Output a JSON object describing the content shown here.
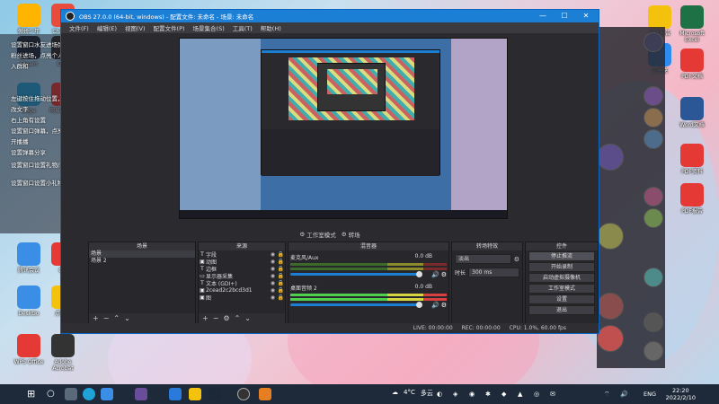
{
  "desktop": {
    "left_icons": [
      {
        "label": "傲娇少年",
        "color": "#ffb400"
      },
      {
        "label": "Chrome",
        "color": "#e74c3c"
      },
      {
        "label": "Steam",
        "color": "#1b2838"
      },
      {
        "label": "OBS",
        "color": "#2a2a2a"
      },
      {
        "label": "Edge",
        "color": "#1fa2d8"
      },
      {
        "label": "网易云音乐",
        "color": "#e53935"
      },
      {
        "label": "腾讯会议",
        "color": "#3a8ee6"
      },
      {
        "label": "QQ",
        "color": "#e53935"
      },
      {
        "label": "DeskGo",
        "color": "#3a8ee6"
      },
      {
        "label": "点道讲",
        "color": "#f4c20d"
      },
      {
        "label": "WPS Office",
        "color": "#e53935"
      },
      {
        "label": "Adobe Acrobat",
        "color": "#333"
      }
    ],
    "right_icons": [
      {
        "label": "实验报告",
        "color": "#f4c20d"
      },
      {
        "label": "Microsoft Excel",
        "color": "#1e7145"
      },
      {
        "label": "文件夹",
        "color": "#2d8cf0"
      },
      {
        "label": "PDF文档",
        "color": "#e53935"
      },
      {
        "label": "Word文档",
        "color": "#2b5797"
      },
      {
        "label": "PDF资料",
        "color": "#e53935"
      },
      {
        "label": "PDF报告",
        "color": "#e53935"
      }
    ],
    "note_lines": [
      "设置窗口水友进场弹幕",
      "粉丝进场，点亮个人勋章",
      "入群和",
      "左键按住拖动位置，左键拉伸边框",
      "改文字",
      "右上角有设置",
      "设置窗口弹幕，点亮开播/续费、粉丝牌",
      "开播播",
      "设置弹幕分享",
      "设置窗口设置礼物/粉丝、弹幕",
      "设置窗口设置小礼物屏幕"
    ]
  },
  "obs": {
    "title": "OBS 27.0.0 (64-bit, windows) - 配置文件: 未命名 - 场景: 未命名",
    "window_buttons": {
      "minimize": "—",
      "maximize": "☐",
      "close": "✕"
    },
    "menu": [
      "文件(F)",
      "编辑(E)",
      "视图(V)",
      "配置文件(P)",
      "场景集合(S)",
      "工具(T)",
      "帮助(H)"
    ],
    "modes": [
      {
        "icon": "⚙",
        "label": "工作室模式"
      },
      {
        "icon": "⚙",
        "label": "转场"
      }
    ],
    "docks": {
      "scenes": {
        "title": "场景",
        "items": [
          "场景",
          "场景 2"
        ]
      },
      "sources": {
        "title": "来源",
        "items": [
          {
            "type": "T",
            "name": "字段"
          },
          {
            "type": "▣",
            "name": "动图"
          },
          {
            "type": "T",
            "name": "边框"
          },
          {
            "type": "▭",
            "name": "显示器采集"
          },
          {
            "type": "T",
            "name": "文本 (GDI+)"
          },
          {
            "type": "▣",
            "name": "2cead2c2bcd3d1"
          },
          {
            "type": "▣",
            "name": "图"
          }
        ]
      },
      "mixer": {
        "title": "混音器",
        "channels": [
          {
            "name": "麦克风/Aux",
            "db": "0.0 dB",
            "active": false
          },
          {
            "name": "桌面音频 2",
            "db": "0.0 dB",
            "active": true
          }
        ]
      },
      "transitions": {
        "title": "转场特效",
        "effect": "淡出",
        "duration_label": "时长",
        "duration_value": "300 ms"
      },
      "controls": {
        "title": "控件",
        "buttons": [
          "停止推流",
          "开始录制",
          "启动虚拟摄像机",
          "工作室模式",
          "设置",
          "退出"
        ]
      }
    },
    "status": {
      "live": "LIVE: 00:00:00",
      "rec": "REC: 00:00:00",
      "cpu": "CPU: 1.0%, 60.00 fps"
    }
  },
  "taskbar": {
    "weather_temp": "4°C",
    "weather_desc": "多云",
    "lang": "ENG",
    "time": "22:20",
    "date": "2022/2/10"
  }
}
